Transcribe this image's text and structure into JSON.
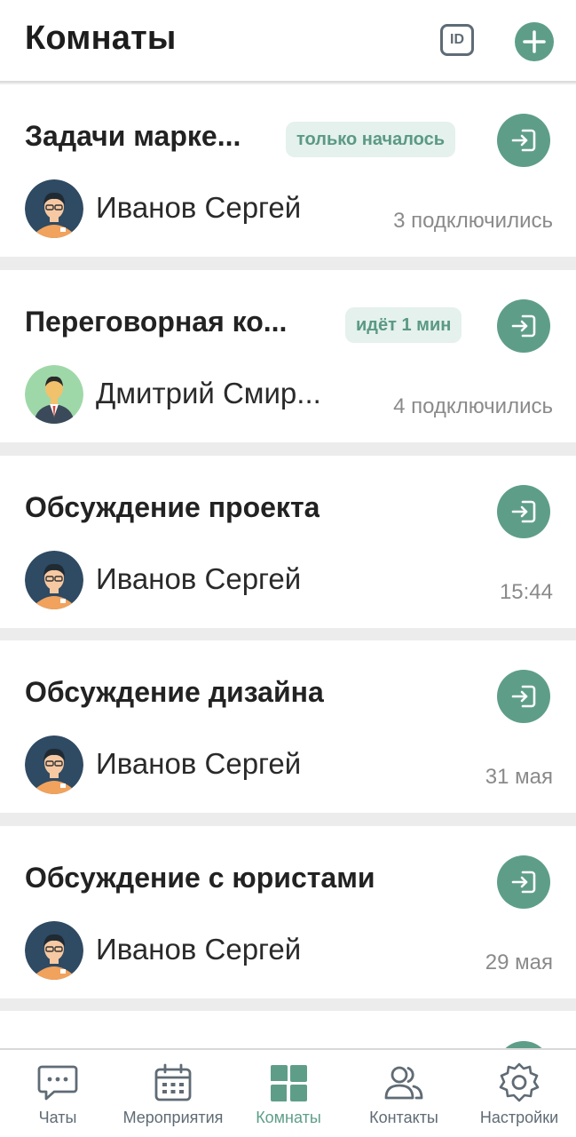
{
  "header": {
    "title": "Комнаты",
    "id_button_label": "ID"
  },
  "rooms": [
    {
      "title": "Задачи марке...",
      "badge": "только началось",
      "owner": "Иванов Сергей",
      "avatar": "avatar-glasses-man",
      "meta": "3 подключились"
    },
    {
      "title": "Переговорная ко...",
      "badge": "идёт 1 мин",
      "owner": "Дмитрий Смир...",
      "avatar": "avatar-businessman",
      "meta": "4 подключились"
    },
    {
      "title": "Обсуждение проекта",
      "owner": "Иванов Сергей",
      "avatar": "avatar-glasses-man",
      "meta": "15:44"
    },
    {
      "title": "Обсуждение дизайна",
      "owner": "Иванов Сергей",
      "avatar": "avatar-glasses-man",
      "meta": "31 мая"
    },
    {
      "title": "Обсуждение с юристами",
      "owner": "Иванов Сергей",
      "avatar": "avatar-glasses-man",
      "meta": "29 мая"
    }
  ],
  "tabs": [
    {
      "label": "Чаты",
      "icon": "chat-icon"
    },
    {
      "label": "Мероприятия",
      "icon": "calendar-icon"
    },
    {
      "label": "Комнаты",
      "icon": "rooms-icon",
      "active": true
    },
    {
      "label": "Контакты",
      "icon": "contacts-icon"
    },
    {
      "label": "Настройки",
      "icon": "gear-icon"
    }
  ],
  "colors": {
    "accent": "#5e9e88",
    "badge_bg": "#e4f1ec",
    "muted": "#8a8a8a",
    "icon_gray": "#5f6b75"
  }
}
